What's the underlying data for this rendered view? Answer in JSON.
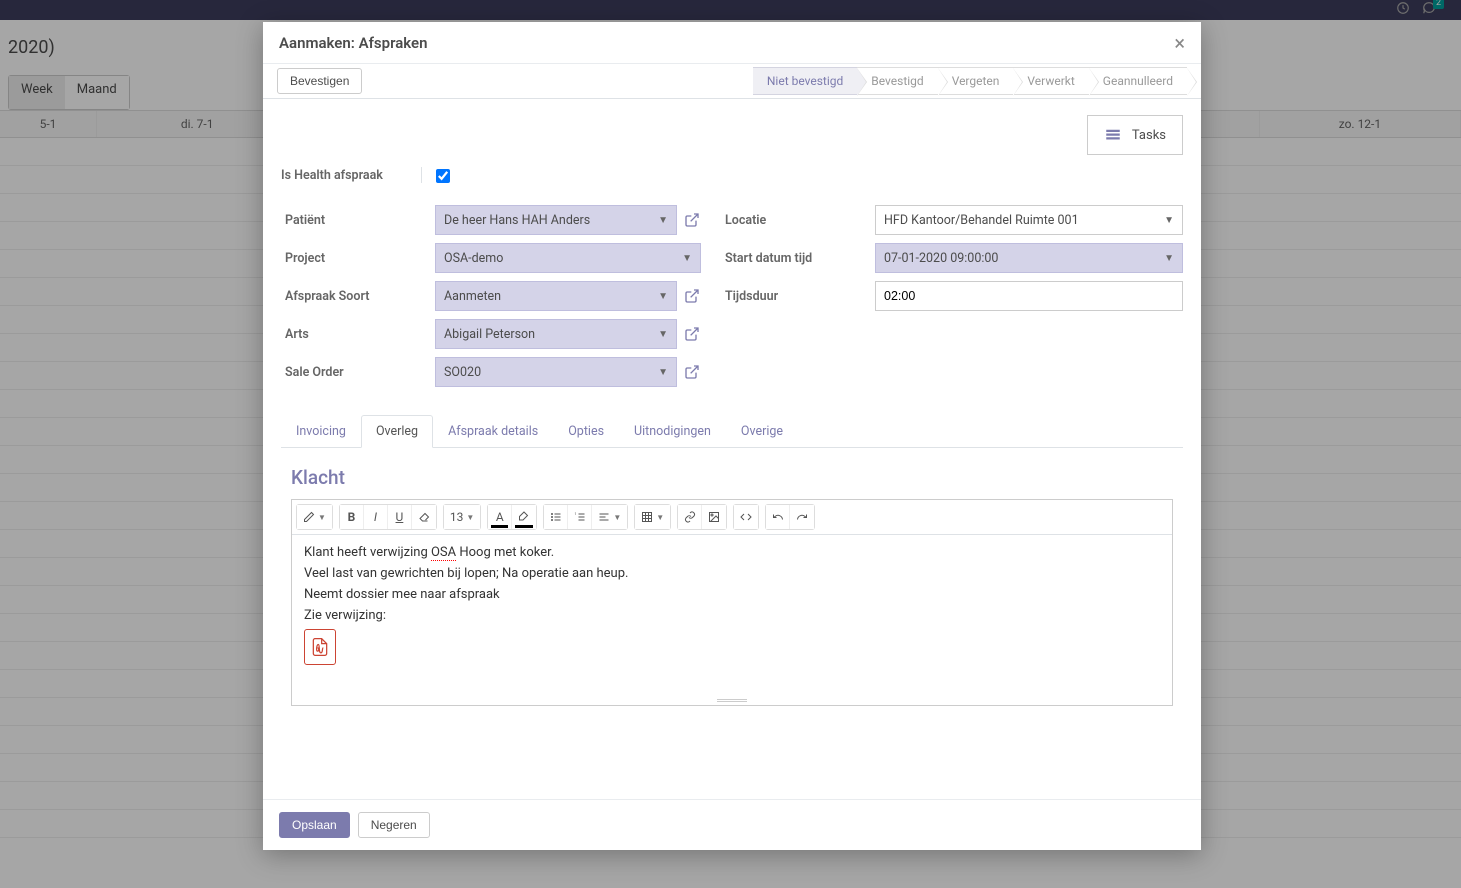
{
  "background": {
    "year_label": "2020)",
    "viewtabs": {
      "week": "Week",
      "month": "Maand"
    },
    "days": [
      "5-1",
      "di. 7-1",
      "zo. 12-1"
    ],
    "chat_badge": "2"
  },
  "modal": {
    "title": "Aanmaken: Afspraken",
    "close_glyph": "×",
    "confirm_btn": "Bevestigen",
    "stages": {
      "niet_bevestigd": "Niet bevestigd",
      "bevestigd": "Bevestigd",
      "vergeten": "Vergeten",
      "verwerkt": "Verwerkt",
      "geannulleerd": "Geannulleerd"
    },
    "tasks_button": "Tasks",
    "fields": {
      "is_health": {
        "label": "Is Health afspraak",
        "checked": true
      },
      "patient": {
        "label": "Patiënt",
        "value": "De heer Hans HAH Anders"
      },
      "project": {
        "label": "Project",
        "value": "OSA-demo"
      },
      "afspraak_soort": {
        "label": "Afspraak Soort",
        "value": "Aanmeten"
      },
      "arts": {
        "label": "Arts",
        "value": "Abigail Peterson"
      },
      "sale_order": {
        "label": "Sale Order",
        "value": "SO020"
      },
      "locatie": {
        "label": "Locatie",
        "value": "HFD Kantoor/Behandel Ruimte 001"
      },
      "start": {
        "label": "Start datum tijd",
        "value": "07-01-2020 09:00:00"
      },
      "tijdsduur": {
        "label": "Tijdsduur",
        "value": "02:00"
      }
    },
    "tabs": {
      "invoicing": "Invoicing",
      "overleg": "Overleg",
      "details": "Afspraak details",
      "opties": "Opties",
      "uitnodigingen": "Uitnodigingen",
      "overige": "Overige"
    },
    "section_klacht": "Klacht",
    "editor": {
      "fontsize": "13",
      "content": {
        "l1a": "Klant heeft verwijzing ",
        "l1_osa": "OSA",
        "l1b": " Hoog met koker.",
        "l2": "Veel last van gewrichten bij lopen; Na operatie aan heup.",
        "l3": "Neemt dossier mee naar afspraak",
        "l4": "Zie verwijzing:"
      }
    },
    "footer": {
      "save": "Opslaan",
      "discard": "Negeren"
    }
  }
}
